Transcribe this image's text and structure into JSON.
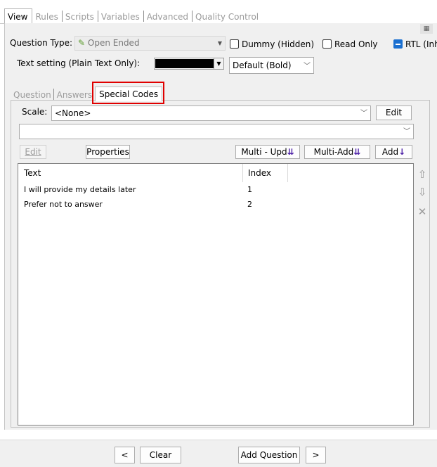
{
  "top_tabs": [
    {
      "label": "View",
      "active": true
    },
    {
      "label": "Rules",
      "active": false
    },
    {
      "label": "Scripts",
      "active": false
    },
    {
      "label": "Variables",
      "active": false
    },
    {
      "label": "Advanced",
      "active": false
    },
    {
      "label": "Quality Control",
      "active": false
    }
  ],
  "question": {
    "type_label": "Question Type:",
    "type_value": "Open Ended",
    "dummy_label": "Dummy (Hidden)",
    "readonly_label": "Read Only",
    "rtl_label": "RTL (Inh",
    "text_setting_label": "Text setting (Plain Text Only):",
    "text_color": "#000000",
    "font_style": "Default (Bold)"
  },
  "inner_tabs": [
    {
      "label": "Question",
      "active": false
    },
    {
      "label": "Answers",
      "active": false
    },
    {
      "label": "Special Codes",
      "active": true
    }
  ],
  "scale": {
    "label": "Scale:",
    "value": "<None>",
    "edit_label": "Edit",
    "second_value": ""
  },
  "toolbar": {
    "edit_label": "Edit",
    "properties_label": "Properties",
    "multi_update_label": "Multi - Upd",
    "multi_add_label": "Multi-Add",
    "add_label": "Add"
  },
  "list": {
    "columns": [
      "Text",
      "Index"
    ],
    "rows": [
      {
        "text": "I will provide my details later",
        "index": "1"
      },
      {
        "text": "Prefer not to answer",
        "index": "2"
      }
    ]
  },
  "side_icons": [
    "move-up-icon",
    "move-down-icon",
    "delete-icon"
  ],
  "bottom": {
    "prev_label": "<",
    "clear_label": "Clear",
    "add_question_label": "Add Question",
    "next_label": ">"
  },
  "colors": {
    "highlight": "#e00000",
    "accent": "#1a6fd0",
    "arrow_icon": "#4b1fa6"
  }
}
